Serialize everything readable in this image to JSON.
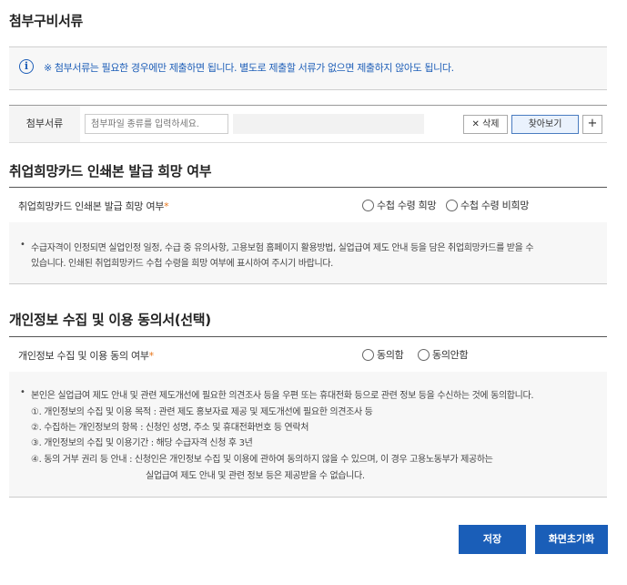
{
  "attachments": {
    "title": "첨부구비서류",
    "notice": "※ 첨부서류는 필요한 경우에만 제출하면 됩니다. 별도로 제출할 서류가 없으면 제출하지 않아도 됩니다.",
    "label": "첨부서류",
    "placeholder": "첨부파일 종류를 입력하세요.",
    "delete_label": "삭제",
    "find_label": "찾아보기",
    "add_label": "+"
  },
  "card": {
    "title": "취업희망카드 인쇄본 발급 희망 여부",
    "question": "취업희망카드 인쇄본 발급 희망 여부",
    "options": [
      "수첩 수령 희망",
      "수첩 수령 비희망"
    ],
    "desc_lines": [
      "수급자격이 인정되면 실업인정 일정, 수급 중 유의사항, 고용보험 홈페이지 활용방법, 실업급여 제도 안내 등을 담은 취업희망카드를 받을 수",
      "있습니다. 인쇄된 취업희망카드 수첩 수령을 희망 여부에 표시하여 주시기 바랍니다."
    ]
  },
  "privacy": {
    "title": "개인정보 수집 및 이용 동의서(선택)",
    "question": "개인정보 수집 및 이용 동의 여부",
    "options": [
      "동의함",
      "동의안함"
    ],
    "desc_lines": [
      "본인은 실업급여 제도 안내 및 관련 제도개선에 필요한 의견조사 등을 우편 또는 휴대전화 등으로 관련 정보 등을 수신하는 것에 동의합니다.",
      "①. 개인정보의 수집 및 이용 목적 : 관련 제도 홍보자료 제공 및 제도개선에 필요한 의견조사 등",
      "②. 수집하는 개인정보의 항목 : 신청인 성명, 주소 및 휴대전화번호 등 연락처",
      "③. 개인정보의 수집 및 이용기간 : 해당 수급자격 신청 후 3년",
      "④. 동의 거부 권리 등 안내 : 신청인은 개인정보 수집 및 이용에 관하여 동의하지 않을 수 있으며, 이 경우 고용노동부가 제공하는",
      "실업급여 제도 안내 및 관련 정보 등은 제공받을 수 없습니다."
    ]
  },
  "actions": {
    "save_label": "저장",
    "reset_label": "화면초기화"
  },
  "colors": {
    "primary": "#1a5eb8",
    "notice_text": "#1f5fb8",
    "required_star": "#e8761b"
  }
}
